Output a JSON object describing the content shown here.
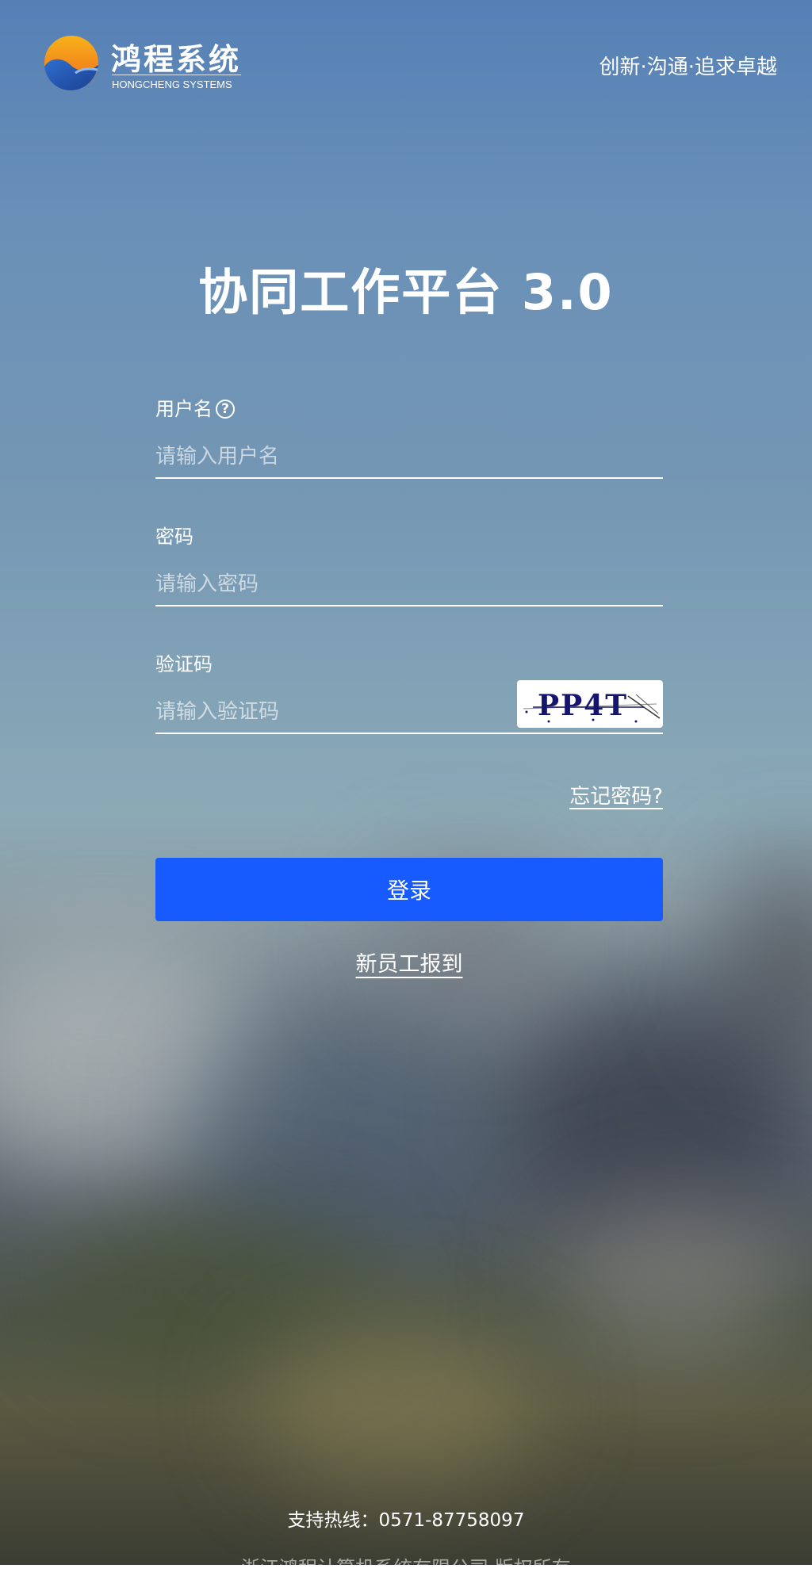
{
  "header": {
    "brand_name": "鸿程系统",
    "brand_sub": "HONGCHENG SYSTEMS",
    "slogan": "创新·沟通·追求卓越"
  },
  "title": "协同工作平台 3.0",
  "form": {
    "username": {
      "label": "用户名",
      "placeholder": "请输入用户名",
      "help_icon": "question-circle-icon"
    },
    "password": {
      "label": "密码",
      "placeholder": "请输入密码"
    },
    "captcha": {
      "label": "验证码",
      "placeholder": "请输入验证码",
      "image_text": "PP4T"
    },
    "forgot_label": "忘记密码?",
    "login_label": "登录",
    "register_label": "新员工报到"
  },
  "footer": {
    "hotline": "支持热线：0571-87758097",
    "copyright": "浙江鸿程计算机系统有限公司 版权所有"
  },
  "colors": {
    "primary_button": "#175bff",
    "logo_orange": "#f5a623",
    "logo_blue": "#1f4fa0"
  }
}
